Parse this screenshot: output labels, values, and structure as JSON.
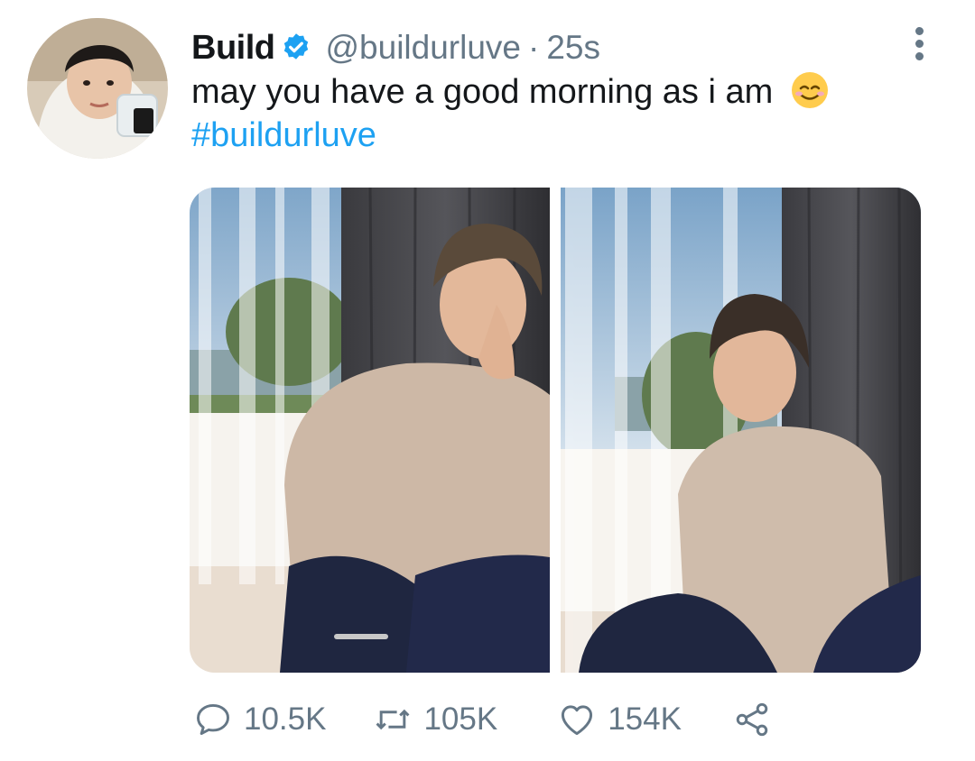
{
  "tweet": {
    "author_name": "Build",
    "handle": "@buildurluve",
    "separator": "·",
    "time": "25s",
    "text": "may you have a good morning as i am",
    "emoji": "smiling-face-with-smiling-eyes",
    "hashtag": "#buildurluve"
  },
  "actions": {
    "reply_count": "10.5K",
    "retweet_count": "105K",
    "like_count": "154K"
  },
  "icons": {
    "verified": "verified-badge-icon",
    "more": "more-vertical-icon",
    "reply": "reply-icon",
    "retweet": "retweet-icon",
    "like": "heart-icon",
    "share": "share-icon"
  },
  "colors": {
    "link": "#1da1f2",
    "muted": "#657786",
    "text": "#14171a"
  }
}
